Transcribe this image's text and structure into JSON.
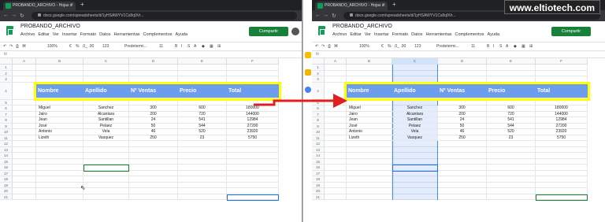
{
  "watermark": "www.eltiotech.com",
  "browser": {
    "tab_title": "PROBANDO_ARCHIVO - Hojas d",
    "url": "docs.google.com/spreadsheets/d/1yHSAWYV1Cs8q9Vr..."
  },
  "sheets": {
    "doc_title": "PROBANDO_ARCHIVO",
    "menus": [
      "Archivo",
      "Editar",
      "Ver",
      "Insertar",
      "Formato",
      "Datos",
      "Herramientas",
      "Complementos",
      "Ayuda"
    ],
    "share_label": "Compartir",
    "toolbar": {
      "zoom": "100%",
      "currency": "€",
      "percent": "%",
      "decimals": ".0_ .00",
      "format": "123",
      "font": "Predetermi...",
      "size": "11"
    },
    "fx": "fx",
    "columns": [
      "A",
      "B",
      "C",
      "D",
      "E",
      "F"
    ],
    "rows": [
      "1",
      "2",
      "3",
      "4",
      "5",
      "6",
      "7",
      "8",
      "9",
      "10",
      "11",
      "12",
      "13",
      "14",
      "15",
      "16",
      "17",
      "18",
      "19",
      "20",
      "21"
    ],
    "headers": [
      "Nombre",
      "Apellido",
      "Nº Ventas",
      "Precio",
      "Total"
    ],
    "data": [
      [
        "Miguel",
        "Sanchez",
        "300",
        "600",
        "180000"
      ],
      [
        "Jairo",
        "Alcantara",
        "200",
        "720",
        "144000"
      ],
      [
        "Jean",
        "Santillan",
        "24",
        "541",
        "12984"
      ],
      [
        "José",
        "Pelaez",
        "50",
        "544",
        "27200"
      ],
      [
        "Antonio",
        "Vela",
        "46",
        "520",
        "23920"
      ],
      [
        "Lizeth",
        "Vasquez",
        "250",
        "23",
        "5750"
      ]
    ]
  },
  "colors": {
    "header_fill": "#6d9eeb",
    "highlight": "#ffff00",
    "arrow": "#e02020",
    "share": "#188038"
  }
}
